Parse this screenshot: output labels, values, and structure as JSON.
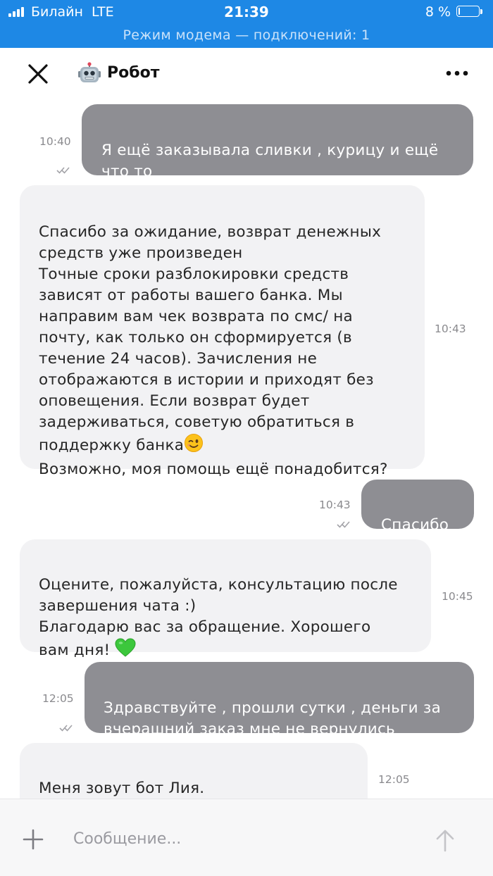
{
  "status_bar": {
    "carrier": "Билайн",
    "network": "LTE",
    "time": "21:39",
    "battery_percent": "8 %",
    "battery_level": 0.08,
    "hotspot_banner": "Режим модема — подключений: 1"
  },
  "header": {
    "title": "Робот",
    "avatar_icon": "robot-emoji",
    "close_icon": "close-icon",
    "more_icon": "more-dots-icon"
  },
  "messages": [
    {
      "direction": "outgoing",
      "time": "10:40",
      "text": "Я ещё заказывала сливки , курицу и ещё\nчто то",
      "status": "read"
    },
    {
      "direction": "incoming",
      "time": "10:43",
      "text_before_emoji": "Спасибо за ожидание, возврат денежных\nсредств уже произведен\nТочные сроки разблокировки средств\nзависят от работы вашего банка. Мы\nнаправим вам чек возврата по смс/ на\nпочту, как только он сформируется (в\nтечение 24 часов). Зачисления не\nотображаются в истории и приходят без\nоповещения. Если возврат будет\nзадерживаться, советую обратиться в\nподдержку банка",
      "emoji": "wink-emoji",
      "text_after_emoji": "\nВозможно, моя помощь ещё понадобится?"
    },
    {
      "direction": "outgoing",
      "time": "10:43",
      "text": "Спасибо",
      "status": "read"
    },
    {
      "direction": "incoming",
      "time": "10:45",
      "text_before_emoji": "Оцените, пожалуйста, консультацию после\nзавершения чата :)\nБлагодарю вас за обращение. Хорошего\nвам дня! ",
      "emoji": "green-heart-emoji"
    },
    {
      "direction": "outgoing",
      "time": "12:05",
      "text": "Здравствуйте , прошли сутки , деньги за\nвчерашний заказ мне не вернулись",
      "status": "read"
    },
    {
      "direction": "incoming",
      "time": "12:05",
      "text": "Меня зовут бот Лия.\nЯ попробую ответить на ваш вопрос"
    }
  ],
  "composer": {
    "placeholder": "Сообщение...",
    "value": "",
    "plus_icon": "plus-icon",
    "send_icon": "send-arrow-icon"
  },
  "colors": {
    "status_bar_bg": "#1e88e5",
    "outgoing_bubble": "#8e8e93",
    "incoming_bubble": "#f2f2f4",
    "timestamp": "#8a8a8e"
  }
}
